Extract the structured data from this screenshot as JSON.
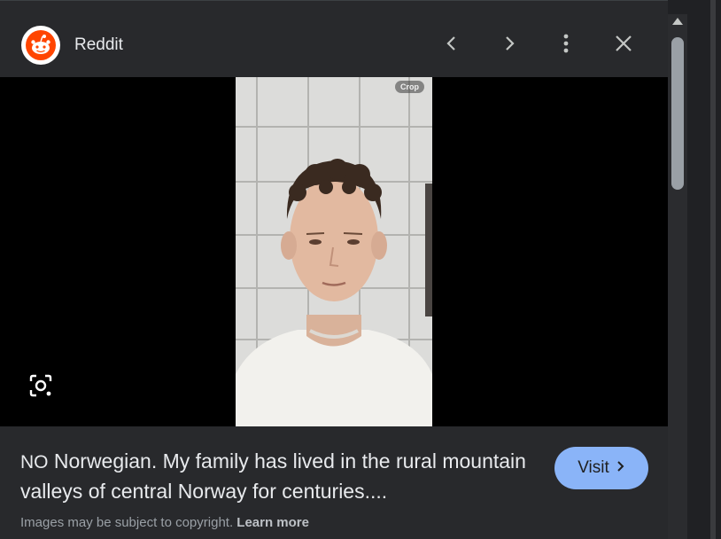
{
  "header": {
    "source_name": "Reddit",
    "logo_icon": "reddit-logo-icon",
    "prev_icon": "chevron-left-icon",
    "next_icon": "chevron-right-icon",
    "more_icon": "more-vert-icon",
    "close_icon": "close-icon"
  },
  "media": {
    "crop_badge": "Crop",
    "lens_icon": "lens-search-icon"
  },
  "caption": {
    "tag": "NO",
    "text": " Norwegian. My family has lived in the rural mountain valleys of central Norway for centuries...."
  },
  "visit": {
    "label": "Visit",
    "icon": "chevron-right-icon"
  },
  "footer": {
    "note": "Images may be subject to copyright. ",
    "learn_more": "Learn more"
  },
  "colors": {
    "panel_bg": "#28292c",
    "accent": "#8ab4f8",
    "reddit_orange": "#ff4500"
  }
}
